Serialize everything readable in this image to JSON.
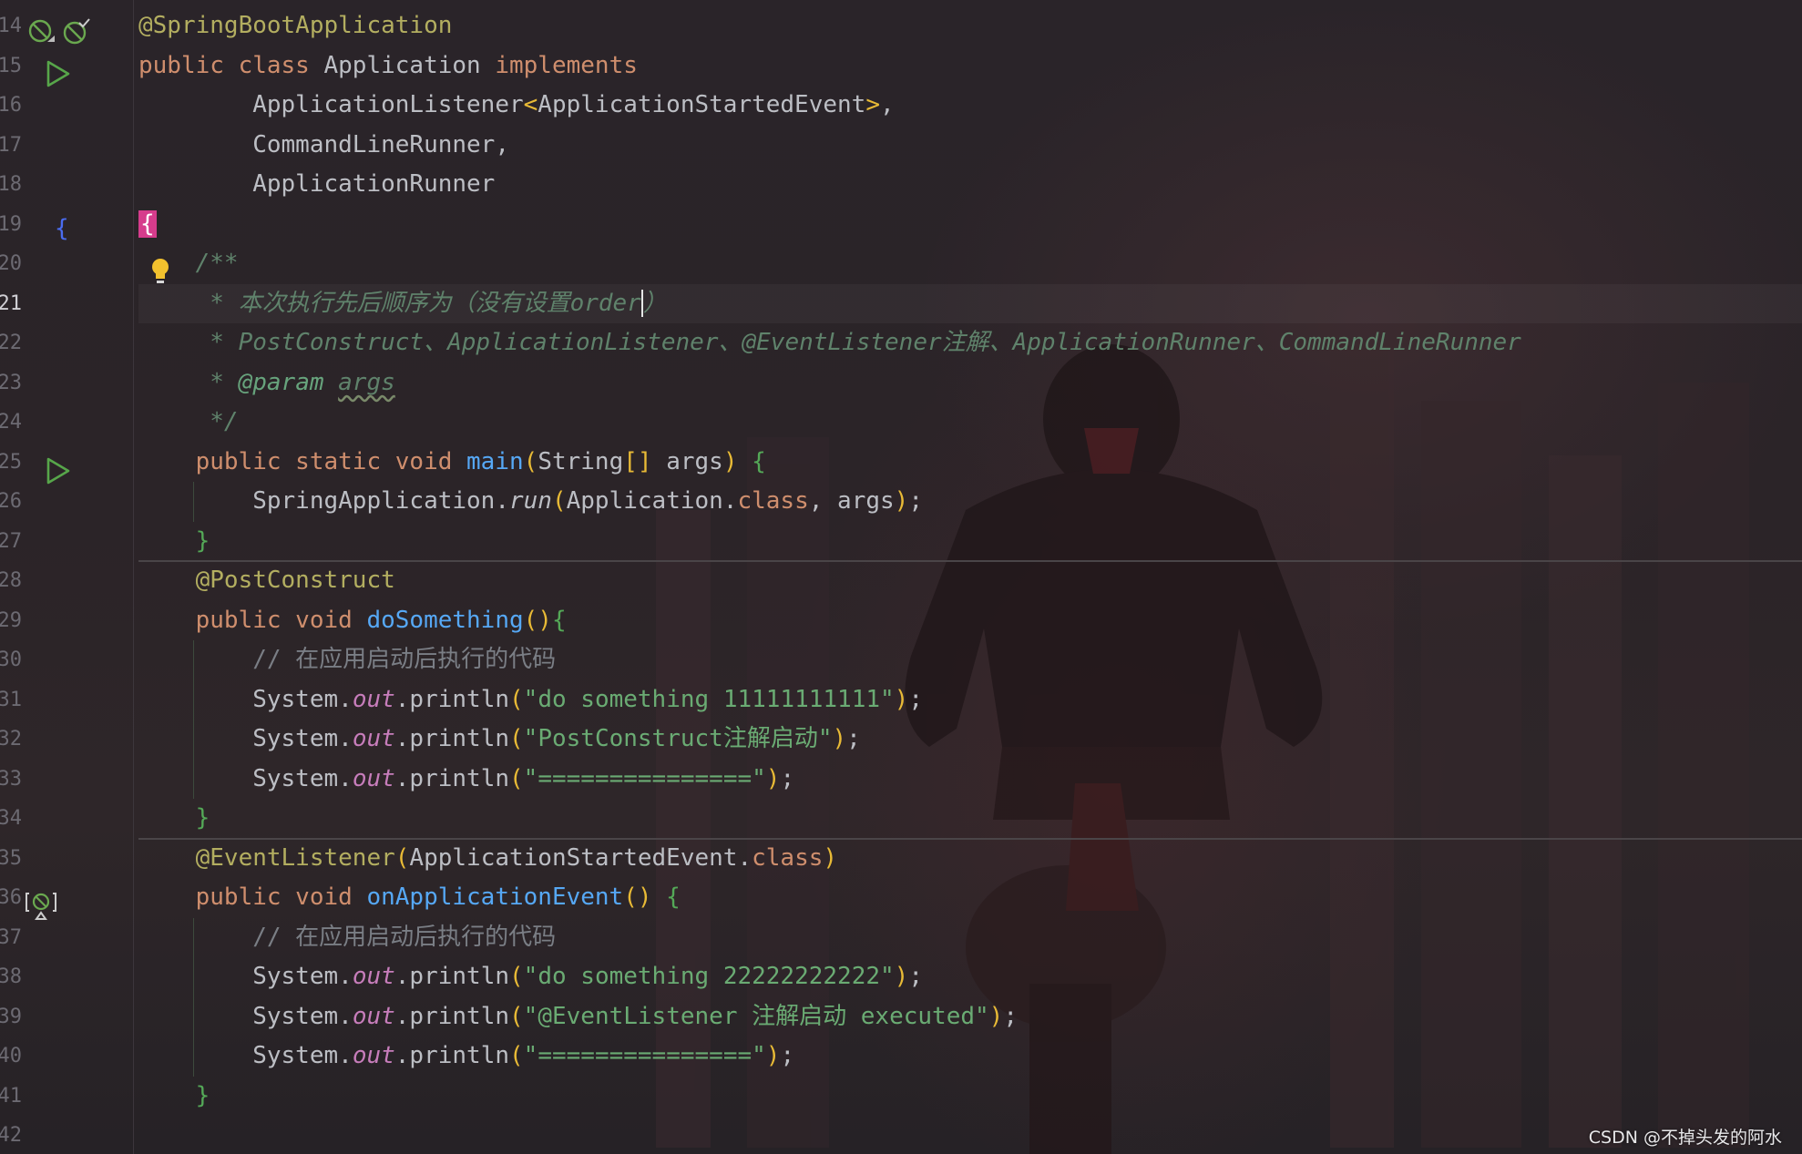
{
  "editor": {
    "lines": [
      {
        "number": "14",
        "tokens": [
          {
            "t": "@SpringBootApplication",
            "c": "c-ann"
          }
        ]
      },
      {
        "number": "15",
        "tokens": [
          {
            "t": "public class ",
            "c": "c-kw"
          },
          {
            "t": "Application ",
            "c": "c-plain"
          },
          {
            "t": "implements",
            "c": "c-kw"
          }
        ]
      },
      {
        "number": "16",
        "tokens": [
          {
            "t": "        ApplicationListener",
            "c": "c-plain"
          },
          {
            "t": "<",
            "c": "c-br"
          },
          {
            "t": "ApplicationStartedEvent",
            "c": "c-plain"
          },
          {
            "t": ">",
            "c": "c-br"
          },
          {
            "t": ",",
            "c": "c-plain"
          }
        ]
      },
      {
        "number": "17",
        "tokens": [
          {
            "t": "        CommandLineRunner,",
            "c": "c-plain"
          }
        ]
      },
      {
        "number": "18",
        "tokens": [
          {
            "t": "        ApplicationRunner",
            "c": "c-plain"
          }
        ]
      },
      {
        "number": "19",
        "tokens": [
          {
            "t": "{",
            "c": "brace-hl"
          }
        ]
      },
      {
        "number": "20",
        "tokens": [
          {
            "t": "    /**",
            "c": "c-doc"
          }
        ]
      },
      {
        "number": "21",
        "tokens": [
          {
            "t": "     * 本次执行先后顺序为（没有设置order",
            "c": "c-doc"
          },
          {
            "t": "",
            "c": "caret"
          },
          {
            "t": "）",
            "c": "c-doc"
          }
        ]
      },
      {
        "number": "22",
        "tokens": [
          {
            "t": "     * PostConstruct、ApplicationListener、@EventListener注解、ApplicationRunner、CommandLineRunner",
            "c": "c-doc"
          }
        ]
      },
      {
        "number": "23",
        "tokens": [
          {
            "t": "     * ",
            "c": "c-doc"
          },
          {
            "t": "@param",
            "c": "c-doctag"
          },
          {
            "t": " ",
            "c": "c-doc"
          },
          {
            "t": "args",
            "c": "c-doc c-sq"
          }
        ]
      },
      {
        "number": "24",
        "tokens": [
          {
            "t": "     */",
            "c": "c-doc"
          }
        ]
      },
      {
        "number": "25",
        "tokens": [
          {
            "t": "    public static void ",
            "c": "c-kw"
          },
          {
            "t": "main",
            "c": "c-fn"
          },
          {
            "t": "(",
            "c": "c-br"
          },
          {
            "t": "String",
            "c": "c-plain"
          },
          {
            "t": "[]",
            "c": "c-br"
          },
          {
            "t": " args",
            "c": "c-plain"
          },
          {
            "t": ")",
            "c": "c-br"
          },
          {
            "t": " {",
            "c": "c-br2"
          }
        ]
      },
      {
        "number": "26",
        "tokens": [
          {
            "t": "        SpringApplication.",
            "c": "c-plain"
          },
          {
            "t": "run",
            "c": "c-plain c-static"
          },
          {
            "t": "(",
            "c": "c-br"
          },
          {
            "t": "Application.",
            "c": "c-plain"
          },
          {
            "t": "class",
            "c": "c-kw"
          },
          {
            "t": ", args",
            "c": "c-plain"
          },
          {
            "t": ")",
            "c": "c-br"
          },
          {
            "t": ";",
            "c": "c-plain"
          }
        ]
      },
      {
        "number": "27",
        "tokens": [
          {
            "t": "    }",
            "c": "c-br2"
          }
        ]
      },
      {
        "number": "28",
        "tokens": [
          {
            "t": "    @PostConstruct",
            "c": "c-ann"
          }
        ]
      },
      {
        "number": "29",
        "tokens": [
          {
            "t": "    public void ",
            "c": "c-kw"
          },
          {
            "t": "doSomething",
            "c": "c-fn"
          },
          {
            "t": "()",
            "c": "c-br"
          },
          {
            "t": "{",
            "c": "c-br2"
          }
        ]
      },
      {
        "number": "30",
        "tokens": [
          {
            "t": "        // 在应用启动后执行的代码",
            "c": "c-cmt"
          }
        ]
      },
      {
        "number": "31",
        "tokens": [
          {
            "t": "        System.",
            "c": "c-plain"
          },
          {
            "t": "out",
            "c": "c-field"
          },
          {
            "t": ".println",
            "c": "c-plain"
          },
          {
            "t": "(",
            "c": "c-br"
          },
          {
            "t": "\"do something 11111111111\"",
            "c": "c-str"
          },
          {
            "t": ")",
            "c": "c-br"
          },
          {
            "t": ";",
            "c": "c-plain"
          }
        ]
      },
      {
        "number": "32",
        "tokens": [
          {
            "t": "        System.",
            "c": "c-plain"
          },
          {
            "t": "out",
            "c": "c-field"
          },
          {
            "t": ".println",
            "c": "c-plain"
          },
          {
            "t": "(",
            "c": "c-br"
          },
          {
            "t": "\"PostConstruct注解启动\"",
            "c": "c-str"
          },
          {
            "t": ")",
            "c": "c-br"
          },
          {
            "t": ";",
            "c": "c-plain"
          }
        ]
      },
      {
        "number": "33",
        "tokens": [
          {
            "t": "        System.",
            "c": "c-plain"
          },
          {
            "t": "out",
            "c": "c-field"
          },
          {
            "t": ".println",
            "c": "c-plain"
          },
          {
            "t": "(",
            "c": "c-br"
          },
          {
            "t": "\"===============\"",
            "c": "c-str"
          },
          {
            "t": ")",
            "c": "c-br"
          },
          {
            "t": ";",
            "c": "c-plain"
          }
        ]
      },
      {
        "number": "34",
        "tokens": [
          {
            "t": "    }",
            "c": "c-br2"
          }
        ]
      },
      {
        "number": "35",
        "tokens": [
          {
            "t": "    @EventListener",
            "c": "c-ann"
          },
          {
            "t": "(",
            "c": "c-br"
          },
          {
            "t": "ApplicationStartedEvent.",
            "c": "c-plain"
          },
          {
            "t": "class",
            "c": "c-kw"
          },
          {
            "t": ")",
            "c": "c-br"
          }
        ]
      },
      {
        "number": "36",
        "tokens": [
          {
            "t": "    public void ",
            "c": "c-kw"
          },
          {
            "t": "onApplicationEvent",
            "c": "c-fn"
          },
          {
            "t": "()",
            "c": "c-br"
          },
          {
            "t": " {",
            "c": "c-br2"
          }
        ]
      },
      {
        "number": "37",
        "tokens": [
          {
            "t": "        // 在应用启动后执行的代码",
            "c": "c-cmt"
          }
        ]
      },
      {
        "number": "38",
        "tokens": [
          {
            "t": "        System.",
            "c": "c-plain"
          },
          {
            "t": "out",
            "c": "c-field"
          },
          {
            "t": ".println",
            "c": "c-plain"
          },
          {
            "t": "(",
            "c": "c-br"
          },
          {
            "t": "\"do something 22222222222\"",
            "c": "c-str"
          },
          {
            "t": ")",
            "c": "c-br"
          },
          {
            "t": ";",
            "c": "c-plain"
          }
        ]
      },
      {
        "number": "39",
        "tokens": [
          {
            "t": "        System.",
            "c": "c-plain"
          },
          {
            "t": "out",
            "c": "c-field"
          },
          {
            "t": ".println",
            "c": "c-plain"
          },
          {
            "t": "(",
            "c": "c-br"
          },
          {
            "t": "\"@EventListener 注解启动 executed\"",
            "c": "c-str"
          },
          {
            "t": ")",
            "c": "c-br"
          },
          {
            "t": ";",
            "c": "c-plain"
          }
        ]
      },
      {
        "number": "40",
        "tokens": [
          {
            "t": "        System.",
            "c": "c-plain"
          },
          {
            "t": "out",
            "c": "c-field"
          },
          {
            "t": ".println",
            "c": "c-plain"
          },
          {
            "t": "(",
            "c": "c-br"
          },
          {
            "t": "\"===============\"",
            "c": "c-str"
          },
          {
            "t": ")",
            "c": "c-br"
          },
          {
            "t": ";",
            "c": "c-plain"
          }
        ]
      },
      {
        "number": "41",
        "tokens": [
          {
            "t": "    }",
            "c": "c-br2"
          }
        ]
      },
      {
        "number": "42",
        "tokens": []
      }
    ],
    "current_line": "21",
    "gutter_fold_brace": "{",
    "gutter_icons": [
      "spring-bean-icon",
      "spring-config-icon",
      "run-class-icon",
      "fold-brace-icon",
      "intention-bulb-icon",
      "run-main-icon",
      "event-listener-icon"
    ]
  },
  "watermark": "CSDN @不掉头发的阿水",
  "colors": {
    "annotation": "#b3ae60",
    "keyword": "#cf8e6d",
    "function": "#56a8f5",
    "string": "#6aab73",
    "static_field": "#c77dbb",
    "doc_comment": "#5f826b",
    "bracket_match": "#d63c8c"
  }
}
